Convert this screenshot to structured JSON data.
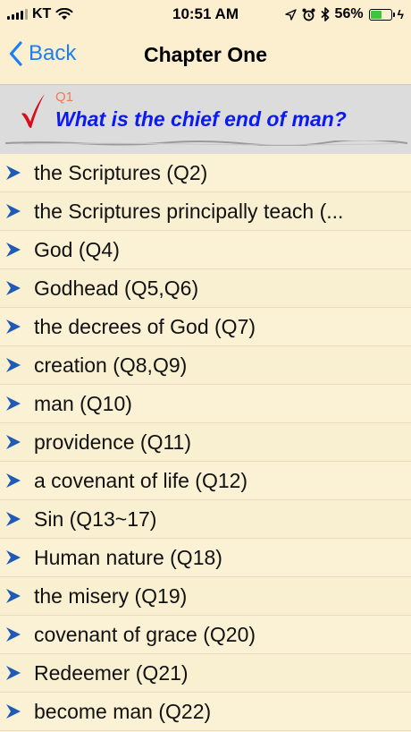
{
  "status_bar": {
    "carrier": "KT",
    "time": "10:51 AM",
    "battery_percent": "56%",
    "battery_level": 0.56,
    "icons": [
      "signal-icon",
      "wifi-icon",
      "location-icon",
      "alarm-icon",
      "bluetooth-icon",
      "battery-icon",
      "charging-icon"
    ]
  },
  "nav": {
    "back_label": "Back",
    "title": "Chapter One"
  },
  "question": {
    "number": "Q1",
    "text": "What is the chief end of man?",
    "icon": "checkmark-icon",
    "color": "#0a1af0",
    "number_color": "#f07a55"
  },
  "list": {
    "icon": "arrow-right-icon",
    "items": [
      {
        "label": "the Scriptures (Q2)"
      },
      {
        "label": "the Scriptures principally teach (..."
      },
      {
        "label": "God (Q4)"
      },
      {
        "label": "Godhead (Q5,Q6)"
      },
      {
        "label": "the decrees of God (Q7)"
      },
      {
        "label": "creation (Q8,Q9)"
      },
      {
        "label": "man (Q10)"
      },
      {
        "label": "providence (Q11)"
      },
      {
        "label": "a covenant of life (Q12)"
      },
      {
        "label": "Sin (Q13~17)"
      },
      {
        "label": "Human nature (Q18)"
      },
      {
        "label": "the misery (Q19)"
      },
      {
        "label": "covenant of grace (Q20)"
      },
      {
        "label": "Redeemer (Q21)"
      },
      {
        "label": "become man (Q22)"
      }
    ]
  },
  "colors": {
    "accent": "#1a7ef5",
    "background": "#fbf1d4",
    "header_bg": "#dcdcdc",
    "arrow": "#1f5bb5"
  }
}
